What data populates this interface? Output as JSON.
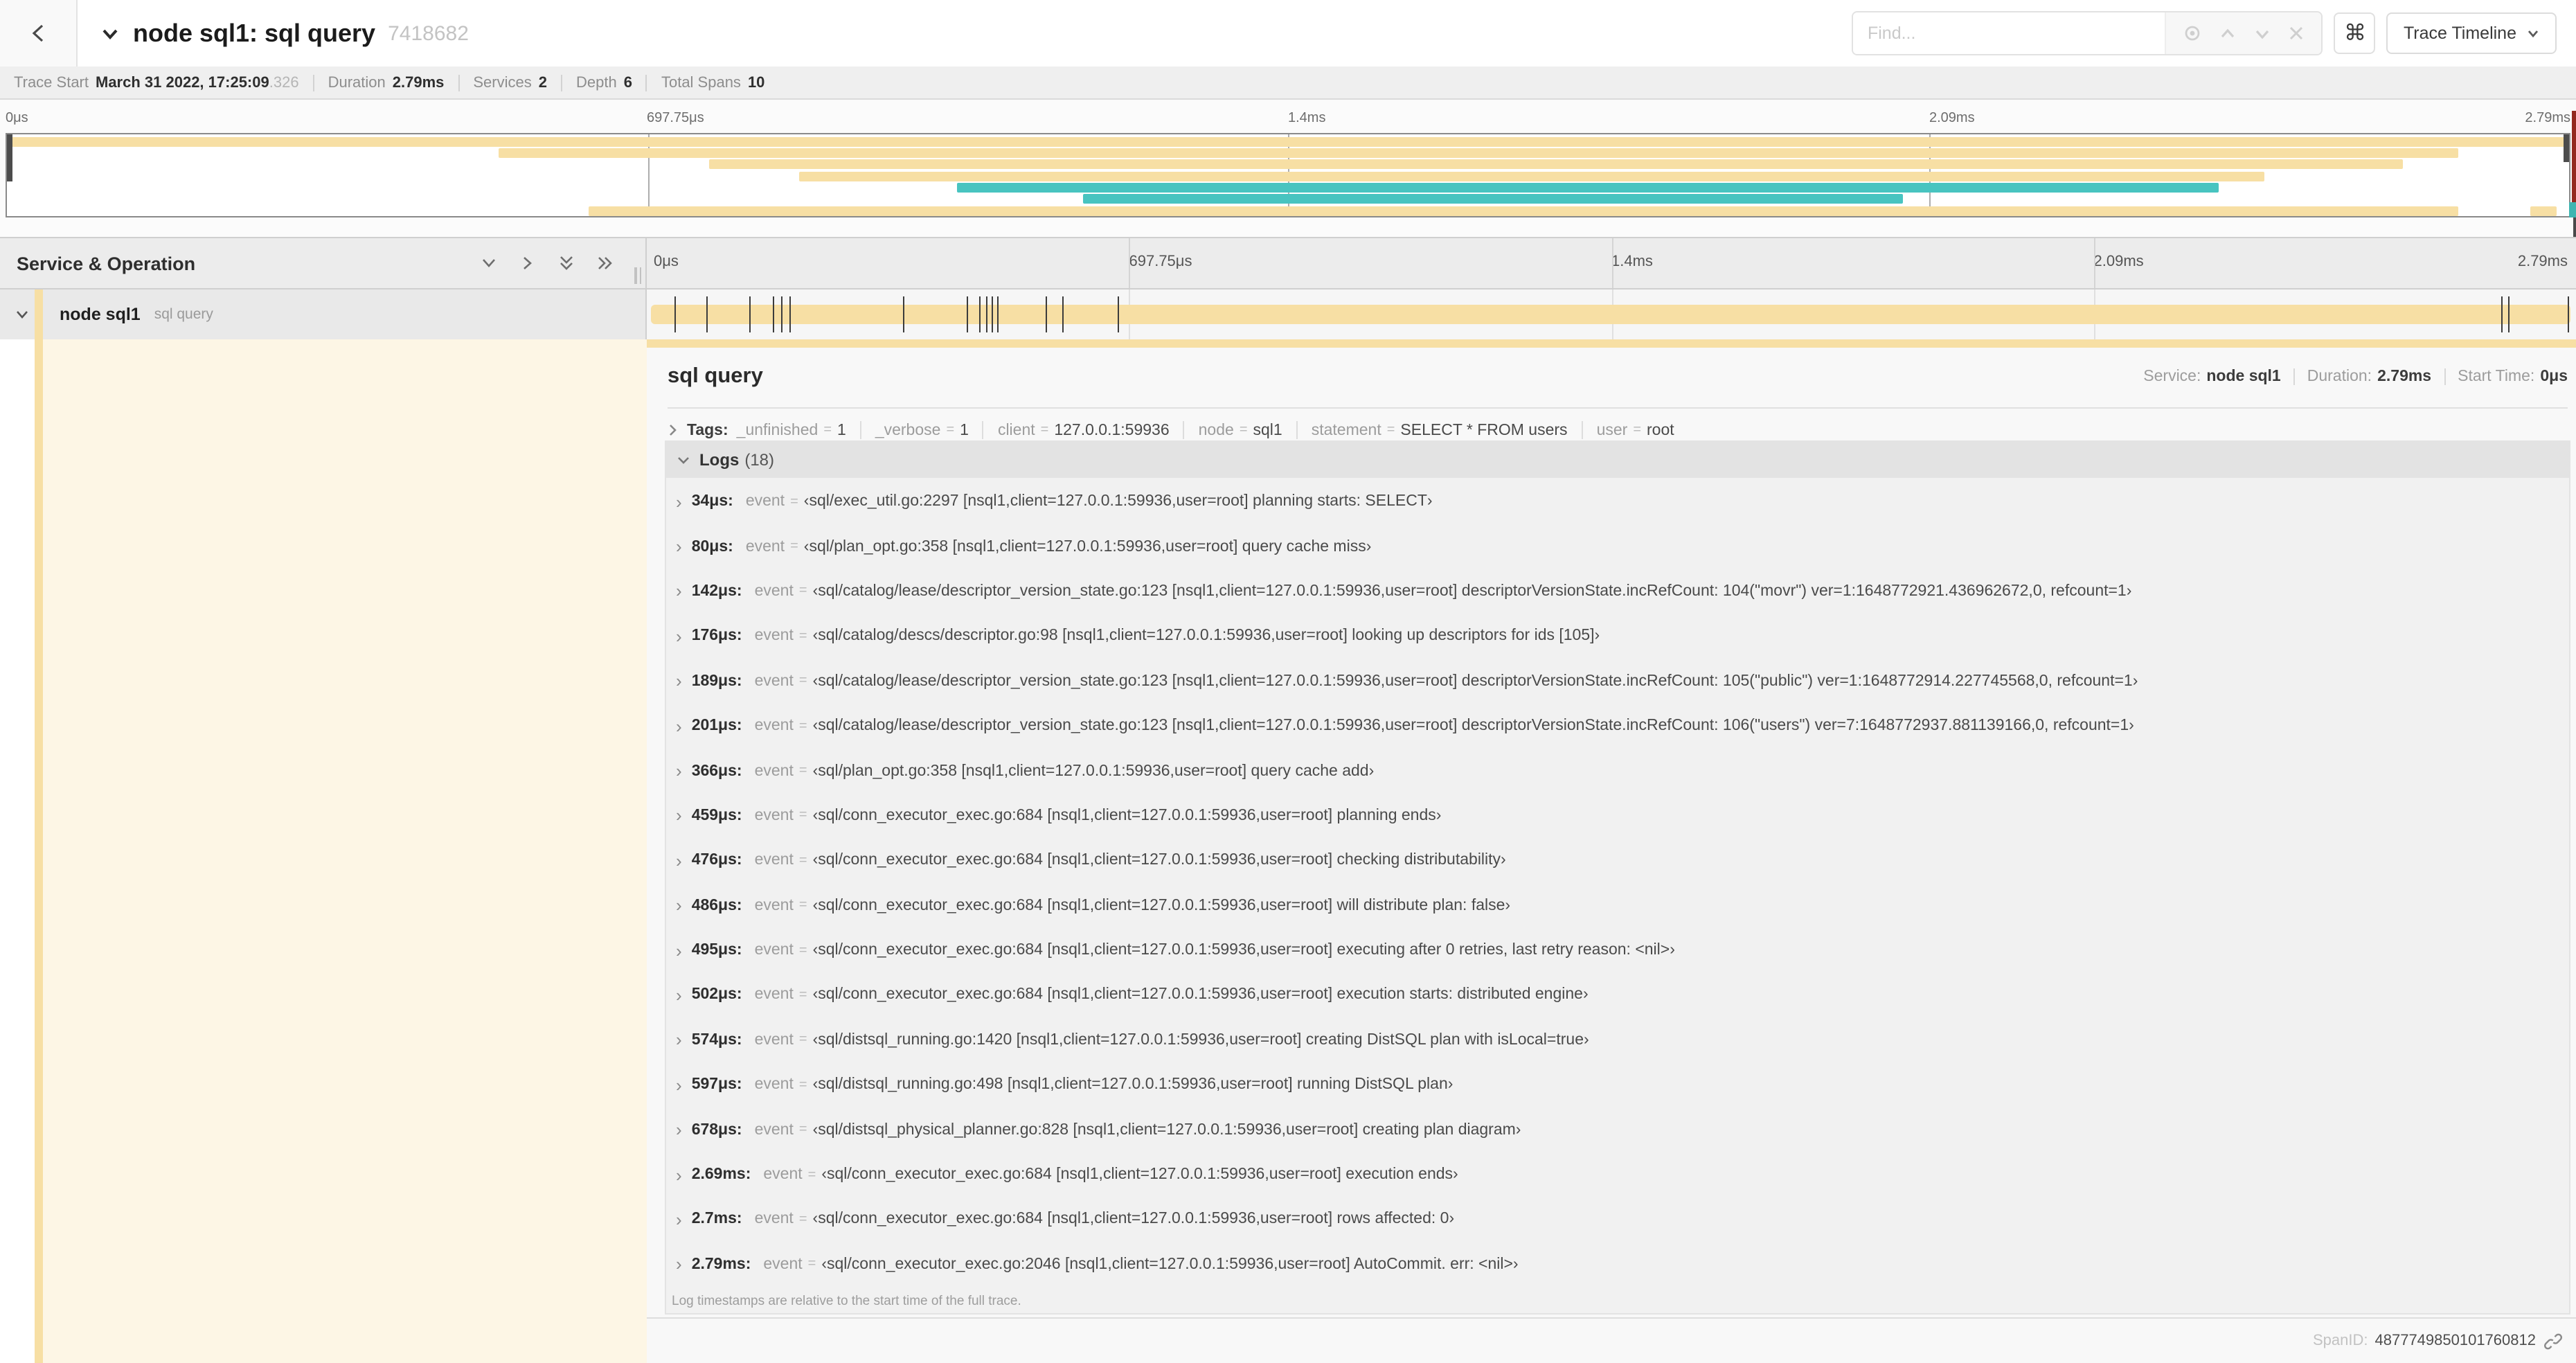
{
  "colors": {
    "yellow": "#f7dfa4",
    "teal": "#48c4c0",
    "cream": "#fdf6e5",
    "selected_row": "#e9e9e9",
    "red_marker": "#93291f"
  },
  "header": {
    "title": "node sql1: sql query",
    "trace_id": "7418682",
    "find_placeholder": "Find...",
    "shortcut_icon": "⌘",
    "view_button": "Trace Timeline"
  },
  "summary": {
    "items": [
      {
        "label": "Trace Start",
        "value": "March 31 2022, 17:25:09",
        "suffix": ".326"
      },
      {
        "label": "Duration",
        "value": "2.79ms",
        "suffix": ""
      },
      {
        "label": "Services",
        "value": "2",
        "suffix": ""
      },
      {
        "label": "Depth",
        "value": "6",
        "suffix": ""
      },
      {
        "label": "Total Spans",
        "value": "10",
        "suffix": ""
      }
    ]
  },
  "timeline": {
    "axis": [
      "0μs",
      "697.75μs",
      "1.4ms",
      "2.09ms",
      "2.79ms"
    ],
    "duration_us": 2790
  },
  "minimap": {
    "bars": [
      {
        "row": 0,
        "start": 0.0,
        "end": 1.0,
        "color": "yellow"
      },
      {
        "row": 1,
        "start": 0.192,
        "end": 0.957,
        "color": "yellow"
      },
      {
        "row": 2,
        "start": 0.274,
        "end": 0.935,
        "color": "yellow"
      },
      {
        "row": 3,
        "start": 0.309,
        "end": 0.881,
        "color": "yellow"
      },
      {
        "row": 4,
        "start": 0.371,
        "end": 0.863,
        "color": "teal"
      },
      {
        "row": 5,
        "start": 0.42,
        "end": 0.74,
        "color": "teal"
      },
      {
        "row": 6,
        "start": 0.227,
        "end": 0.957,
        "color": "yellow"
      },
      {
        "row": 6,
        "start": 0.985,
        "end": 0.995,
        "color": "yellow"
      }
    ]
  },
  "grid": {
    "left_header": "Service & Operation"
  },
  "row": {
    "service": "node sql1",
    "operation": "sql query"
  },
  "detail": {
    "title": "sql query",
    "meta": [
      {
        "label": "Service:",
        "value": "node sql1"
      },
      {
        "label": "Duration:",
        "value": "2.79ms"
      },
      {
        "label": "Start Time:",
        "value": "0μs"
      }
    ],
    "tags_label": "Tags:",
    "tags": [
      {
        "key": "_unfinished",
        "value": "1"
      },
      {
        "key": "_verbose",
        "value": "1"
      },
      {
        "key": "client",
        "value": "127.0.0.1:59936"
      },
      {
        "key": "node",
        "value": "sql1"
      },
      {
        "key": "statement",
        "value": "SELECT * FROM users"
      },
      {
        "key": "user",
        "value": "root"
      }
    ],
    "logs_label": "Logs",
    "logs_count": "(18)",
    "logs_field": "event",
    "logs": [
      {
        "time": "34μs:",
        "t_us": 34,
        "value": "‹sql/exec_util.go:2297 [nsql1,client=127.0.0.1:59936,user=root] planning starts: SELECT›"
      },
      {
        "time": "80μs:",
        "t_us": 80,
        "value": "‹sql/plan_opt.go:358 [nsql1,client=127.0.0.1:59936,user=root] query cache miss›"
      },
      {
        "time": "142μs:",
        "t_us": 142,
        "value": "‹sql/catalog/lease/descriptor_version_state.go:123 [nsql1,client=127.0.0.1:59936,user=root] descriptorVersionState.incRefCount: 104(\"movr\") ver=1:1648772921.436962672,0, refcount=1›"
      },
      {
        "time": "176μs:",
        "t_us": 176,
        "value": "‹sql/catalog/descs/descriptor.go:98 [nsql1,client=127.0.0.1:59936,user=root] looking up descriptors for ids [105]›"
      },
      {
        "time": "189μs:",
        "t_us": 189,
        "value": "‹sql/catalog/lease/descriptor_version_state.go:123 [nsql1,client=127.0.0.1:59936,user=root] descriptorVersionState.incRefCount: 105(\"public\") ver=1:1648772914.227745568,0, refcount=1›"
      },
      {
        "time": "201μs:",
        "t_us": 201,
        "value": "‹sql/catalog/lease/descriptor_version_state.go:123 [nsql1,client=127.0.0.1:59936,user=root] descriptorVersionState.incRefCount: 106(\"users\") ver=7:1648772937.881139166,0, refcount=1›"
      },
      {
        "time": "366μs:",
        "t_us": 366,
        "value": "‹sql/plan_opt.go:358 [nsql1,client=127.0.0.1:59936,user=root] query cache add›"
      },
      {
        "time": "459μs:",
        "t_us": 459,
        "value": "‹sql/conn_executor_exec.go:684 [nsql1,client=127.0.0.1:59936,user=root] planning ends›"
      },
      {
        "time": "476μs:",
        "t_us": 476,
        "value": "‹sql/conn_executor_exec.go:684 [nsql1,client=127.0.0.1:59936,user=root] checking distributability›"
      },
      {
        "time": "486μs:",
        "t_us": 486,
        "value": "‹sql/conn_executor_exec.go:684 [nsql1,client=127.0.0.1:59936,user=root] will distribute plan: false›"
      },
      {
        "time": "495μs:",
        "t_us": 495,
        "value": "‹sql/conn_executor_exec.go:684 [nsql1,client=127.0.0.1:59936,user=root] executing after 0 retries, last retry reason: <nil>›"
      },
      {
        "time": "502μs:",
        "t_us": 502,
        "value": "‹sql/conn_executor_exec.go:684 [nsql1,client=127.0.0.1:59936,user=root] execution starts: distributed engine›"
      },
      {
        "time": "574μs:",
        "t_us": 574,
        "value": "‹sql/distsql_running.go:1420 [nsql1,client=127.0.0.1:59936,user=root] creating DistSQL plan with isLocal=true›"
      },
      {
        "time": "597μs:",
        "t_us": 597,
        "value": "‹sql/distsql_running.go:498 [nsql1,client=127.0.0.1:59936,user=root] running DistSQL plan›"
      },
      {
        "time": "678μs:",
        "t_us": 678,
        "value": "‹sql/distsql_physical_planner.go:828 [nsql1,client=127.0.0.1:59936,user=root] creating plan diagram›"
      },
      {
        "time": "2.69ms:",
        "t_us": 2690,
        "value": "‹sql/conn_executor_exec.go:684 [nsql1,client=127.0.0.1:59936,user=root] execution ends›"
      },
      {
        "time": "2.7ms:",
        "t_us": 2700,
        "value": "‹sql/conn_executor_exec.go:684 [nsql1,client=127.0.0.1:59936,user=root] rows affected: 0›"
      },
      {
        "time": "2.79ms:",
        "t_us": 2790,
        "value": "‹sql/conn_executor_exec.go:2046 [nsql1,client=127.0.0.1:59936,user=root] AutoCommit. err: <nil>›"
      }
    ],
    "logs_note": "Log timestamps are relative to the start time of the full trace.",
    "spanid_label": "SpanID:",
    "spanid": "4877749850101760812"
  }
}
